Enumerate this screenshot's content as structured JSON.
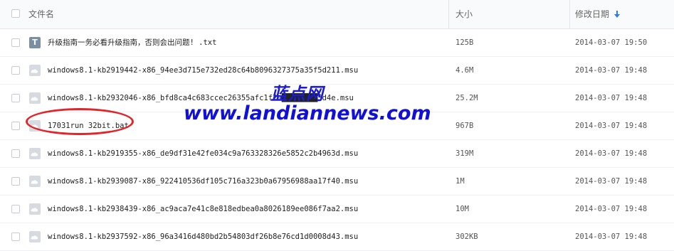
{
  "header": {
    "name_label": "文件名",
    "size_label": "大小",
    "date_label": "修改日期"
  },
  "files": [
    {
      "icon": "text-file-icon",
      "name": "升级指南一务必看升级指南，否则会出问题! .txt",
      "size": "125B",
      "date": "2014-03-07 19:50"
    },
    {
      "icon": "cloud-file-icon",
      "name": "windows8.1-kb2919442-x86_94ee3d715e732ed28c64b8096327375a35f5d211.msu",
      "size": "4.6M",
      "date": "2014-03-07 19:48"
    },
    {
      "icon": "cloud-file-icon",
      "name": "windows8.1-kb2932046-x86_bfd8ca4c683ccec26355afc1f2e████████5d4e.msu",
      "size": "25.2M",
      "date": "2014-03-07 19:48"
    },
    {
      "icon": "cloud-file-icon",
      "name": "17031run 32bit.bat",
      "size": "967B",
      "date": "2014-03-07 19:48"
    },
    {
      "icon": "cloud-file-icon",
      "name": "windows8.1-kb2919355-x86_de9df31e42fe034c9a763328326e5852c2b4963d.msu",
      "size": "319M",
      "date": "2014-03-07 19:48"
    },
    {
      "icon": "cloud-file-icon",
      "name": "windows8.1-kb2939087-x86_922410536df105c716a323b0a67956988aa17f40.msu",
      "size": "1M",
      "date": "2014-03-07 19:48"
    },
    {
      "icon": "cloud-file-icon",
      "name": "windows8.1-kb2938439-x86_ac9aca7e41c8e818edbea0a8026189ee086f7aa2.msu",
      "size": "10M",
      "date": "2014-03-07 19:48"
    },
    {
      "icon": "cloud-file-icon",
      "name": "windows8.1-kb2937592-x86_96a3416d480bd2b54803df26b8e76cd1d0008d43.msu",
      "size": "302KB",
      "date": "2014-03-07 19:48"
    }
  ],
  "watermark": {
    "site_name": "蓝点网",
    "url": "www.landiannews.com"
  },
  "colors": {
    "watermark_blue": "#1010d8",
    "highlight_red": "#e0262b",
    "sort_arrow": "#2b7de1"
  },
  "sort": {
    "column": "date",
    "direction": "descending"
  }
}
